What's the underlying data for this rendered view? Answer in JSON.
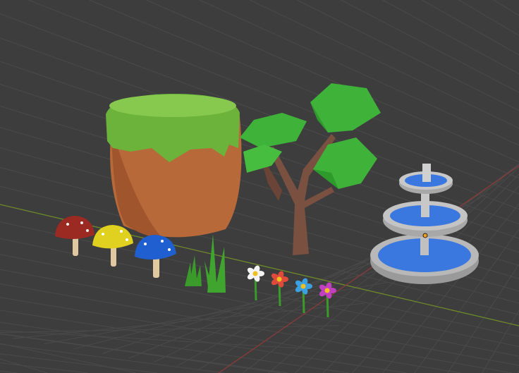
{
  "viewport": {
    "background": "#3d3d3d",
    "grid_color": "#4a4a4a",
    "x_axis_color": "#8a3a3a",
    "y_axis_color": "#6d8a2a"
  },
  "colors": {
    "grass": "#6bb33a",
    "dirt": "#b8693a",
    "leaves": "#3fb23a",
    "trunk": "#7a5040",
    "water": "#3a78e0",
    "stone": "#a8a8a8",
    "mushroom_red": "#9a2a22",
    "mushroom_yellow": "#e0d020",
    "mushroom_blue": "#1f5fd0",
    "origin": "#f0a020"
  }
}
